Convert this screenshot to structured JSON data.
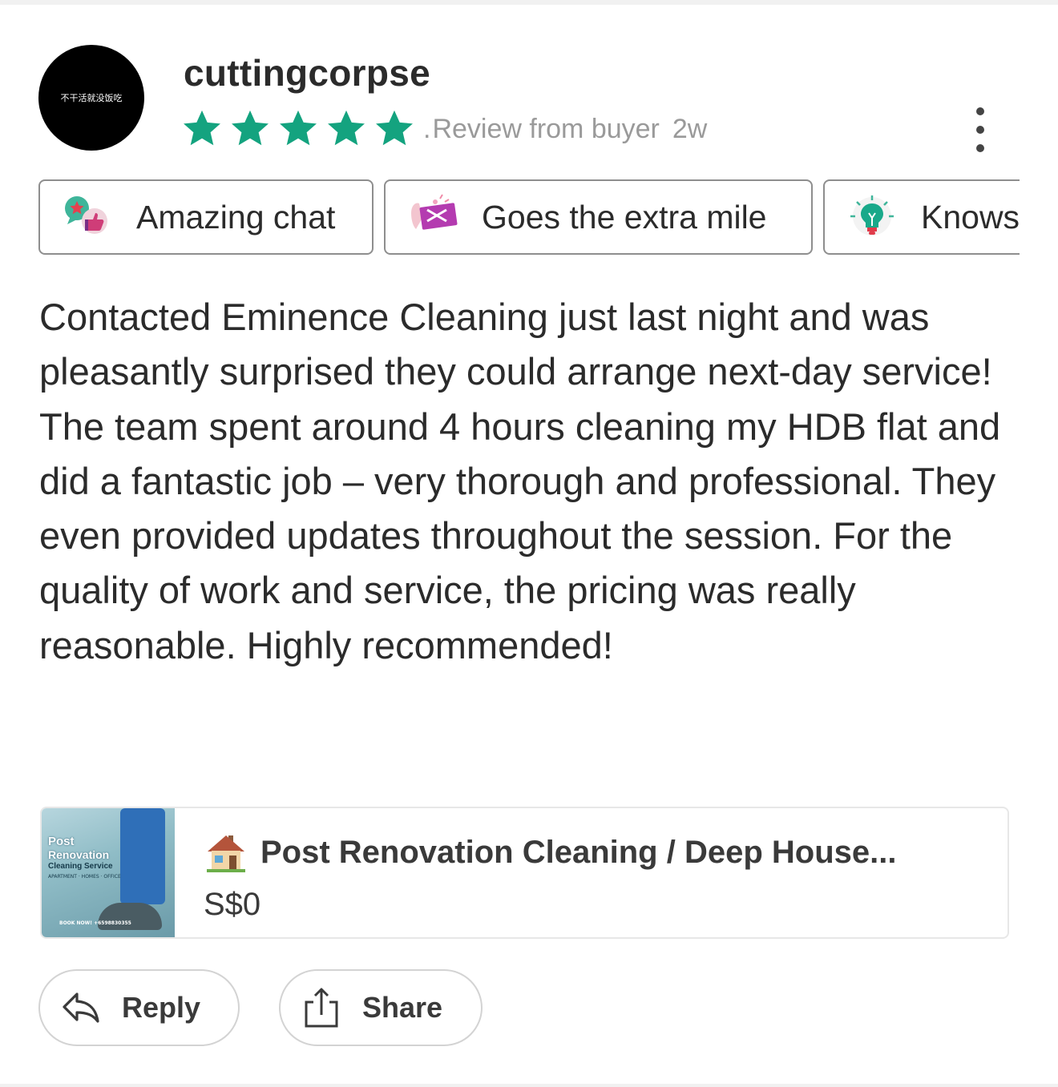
{
  "review": {
    "username": "cuttingcorpse",
    "avatar_text": "不干活就没饭吃",
    "rating": 5,
    "rating_max": 5,
    "star_color": "#14a37f",
    "meta_separator": ".",
    "meta_label": "Review from buyer",
    "meta_time": "2w",
    "more_icon": "more-vertical-icon"
  },
  "chips": [
    {
      "label": "Amazing chat",
      "icon": "chat-thumbs-up-icon"
    },
    {
      "label": "Goes the extra mile",
      "icon": "extra-mile-ticket-icon"
    },
    {
      "label": "Knows",
      "icon": "lightbulb-icon"
    }
  ],
  "body_text": "Contacted Eminence Cleaning just last night and was pleasantly surprised they could arrange next-day service! The team spent around 4 hours cleaning my HDB flat and did a fantastic job – very thorough and professional. They even provided updates throughout the session. For the quality of work and service, the pricing was really reasonable. Highly recommended!",
  "listing": {
    "icon": "house-icon",
    "title": "Post Renovation Cleaning / Deep House...",
    "price": "S$0",
    "thumbnail": {
      "line1": "Post",
      "line2": "Renovation",
      "line3": "Cleaning Service",
      "line4": "APARTMENT · HOMES · OFFICE",
      "line5": "BOOK NOW! +6598830355"
    }
  },
  "actions": {
    "reply_label": "Reply",
    "share_label": "Share"
  }
}
